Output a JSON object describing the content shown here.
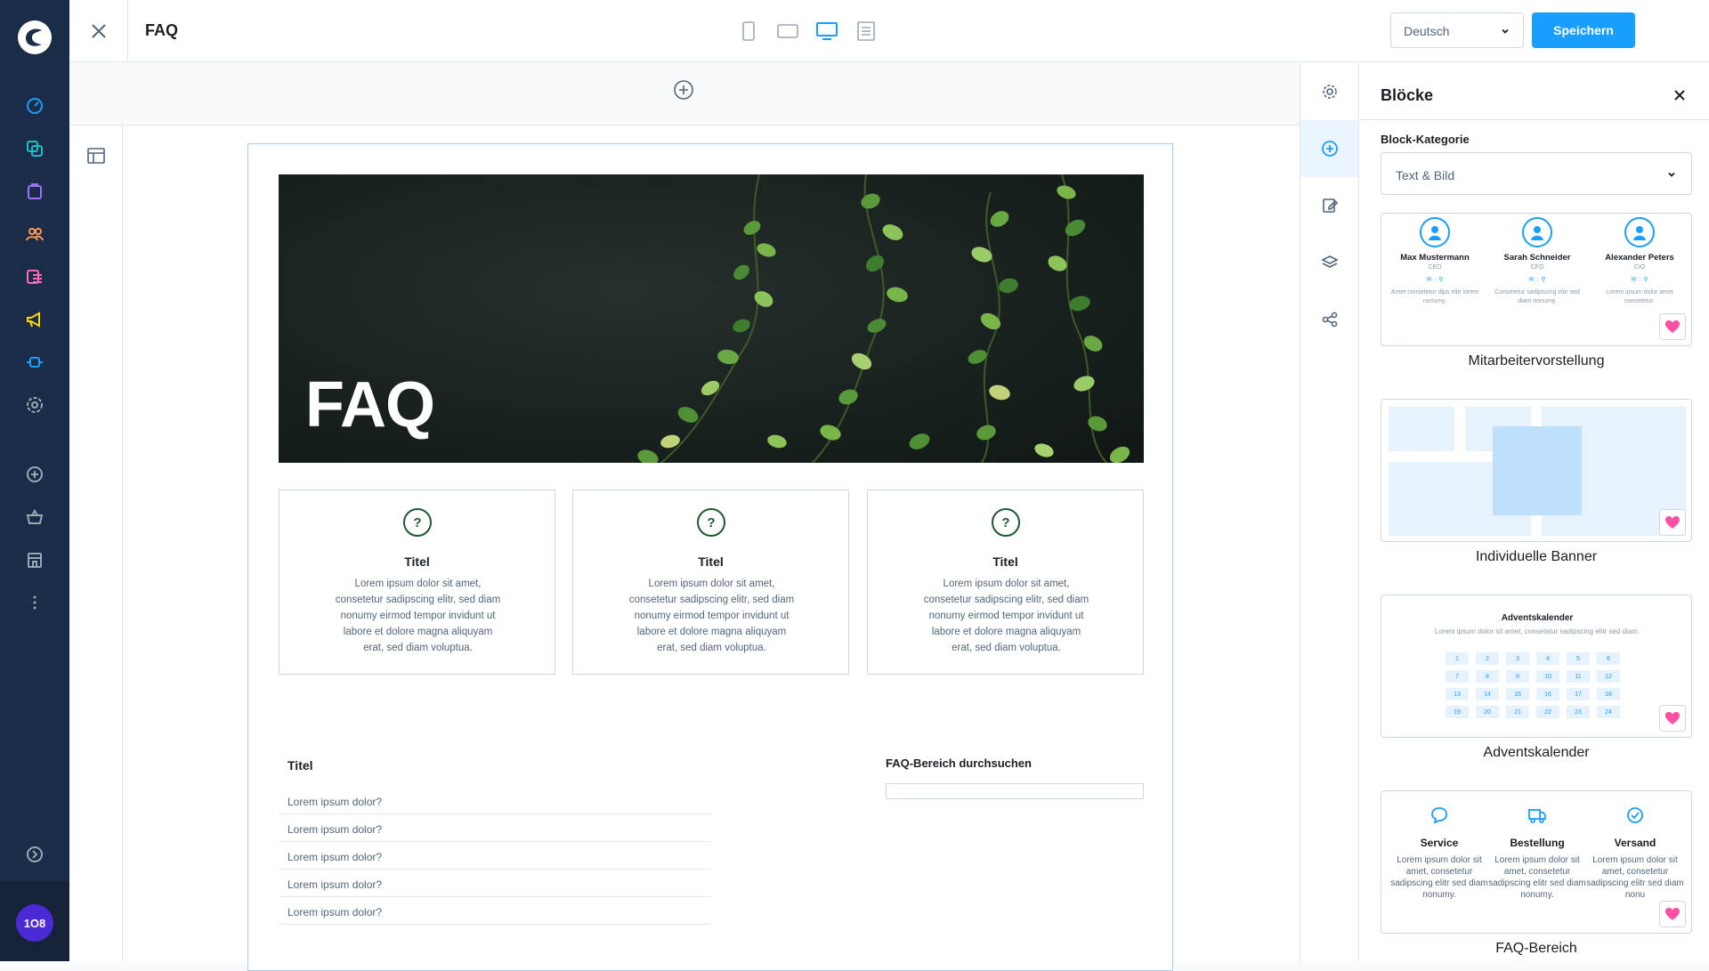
{
  "sidebar": {
    "icons": [
      "dashboard-icon",
      "catalog-icon",
      "orders-icon",
      "customers-icon",
      "content-icon",
      "marketing-icon",
      "extensions-icon",
      "settings-icon",
      "add-icon",
      "basket-icon",
      "store-icon",
      "more-icon",
      "expand-icon"
    ],
    "avatar_text": "1O8"
  },
  "topbar": {
    "title": "FAQ",
    "language": "Deutsch",
    "save_label": "Speichern",
    "devices": [
      "mobile-icon",
      "tablet-icon",
      "desktop-icon",
      "form-icon"
    ]
  },
  "canvas": {
    "hero_title": "FAQ",
    "cards": [
      {
        "title": "Titel",
        "text": "Lorem ipsum dolor sit amet, consetetur sadipscing elitr, sed diam nonumy eirmod tempor invidunt ut labore et dolore magna aliquyam erat, sed diam voluptua."
      },
      {
        "title": "Titel",
        "text": "Lorem ipsum dolor sit amet, consetetur sadipscing elitr, sed diam nonumy eirmod tempor invidunt ut labore et dolore magna aliquyam erat, sed diam voluptua."
      },
      {
        "title": "Titel",
        "text": "Lorem ipsum dolor sit amet, consetetur sadipscing elitr, sed diam nonumy eirmod tempor invidunt ut labore et dolore magna aliquyam erat, sed diam voluptua."
      }
    ],
    "faq_title": "Titel",
    "faq_items": [
      "Lorem ipsum dolor?",
      "Lorem ipsum dolor?",
      "Lorem ipsum dolor?",
      "Lorem ipsum dolor?",
      "Lorem ipsum dolor?"
    ],
    "search_title": "FAQ-Bereich durchsuchen"
  },
  "panel": {
    "title": "Blöcke",
    "category_label": "Block-Kategorie",
    "category_value": "Text & Bild",
    "blocks": [
      {
        "name": "Mitarbeitervorstellung"
      },
      {
        "name": "Individuelle Banner"
      },
      {
        "name": "Adventskalender"
      },
      {
        "name": "FAQ-Bereich"
      }
    ],
    "employees": [
      {
        "name": "Max Mustermann",
        "role": "CEO",
        "social": "✉ ◌ ⚲",
        "text": "Amet consetetur dips elitr lorem nonumy."
      },
      {
        "name": "Sarah Schneider",
        "role": "CFO",
        "social": "✉ ◌ ⚲",
        "text": "Consetetur sadipscing elitr sed diam nonumy."
      },
      {
        "name": "Alexander Peters",
        "role": "CIO",
        "social": "✉ ◌ ⚲",
        "text": "Lorem ipsum dolor amet consetetur."
      }
    ],
    "advent_title": "Adventskalender",
    "advent_subtitle": "Lorem ipsum dolor sit amet, consetetur sadipscing elitr sed diam.",
    "advent_days": [
      "1",
      "2",
      "3",
      "4",
      "5",
      "6",
      "7",
      "8",
      "9",
      "10",
      "11",
      "12",
      "13",
      "14",
      "15",
      "16",
      "17",
      "18",
      "19",
      "20",
      "21",
      "22",
      "23",
      "24"
    ],
    "faq_blocks": [
      {
        "title": "Service",
        "text": "Lorem ipsum dolor sit amet, consetetur sadipscing elitr sed diam nonumy."
      },
      {
        "title": "Bestellung",
        "text": "Lorem ipsum dolor sit amet, consetetur sadipscing elitr sed diam nonumy."
      },
      {
        "title": "Versand",
        "text": "Lorem ipsum dolor sit amet, consetetur sadipscing elitr sed diam nonu"
      }
    ]
  },
  "colors": {
    "sidebar": "#1a2c47",
    "accent": "#189eff",
    "favorite": "#ff4fa3",
    "question": "#1e5a2f"
  }
}
